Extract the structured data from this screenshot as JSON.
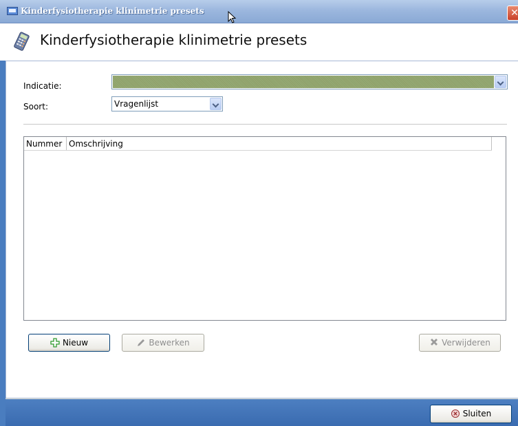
{
  "window": {
    "title": "Kinderfysiotherapie klinimetrie presets",
    "close_symbol": "✕"
  },
  "header": {
    "title": "Kinderfysiotherapie klinimetrie presets",
    "icon": "calculator-icon"
  },
  "form": {
    "indicatie_label": "Indicatie:",
    "indicatie_value": "",
    "soort_label": "Soort:",
    "soort_value": "Vragenlijst"
  },
  "table": {
    "columns": [
      "Nummer",
      "Omschrijving"
    ],
    "rows": []
  },
  "buttons": {
    "nieuw": "Nieuw",
    "bewerken": "Bewerken",
    "verwijderen": "Verwijderen",
    "sluiten": "Sluiten"
  },
  "colors": {
    "accent": "#3a6bb0",
    "indicatie_fill": "#8ea16b",
    "nieuw_icon": "#2e9a2e"
  }
}
